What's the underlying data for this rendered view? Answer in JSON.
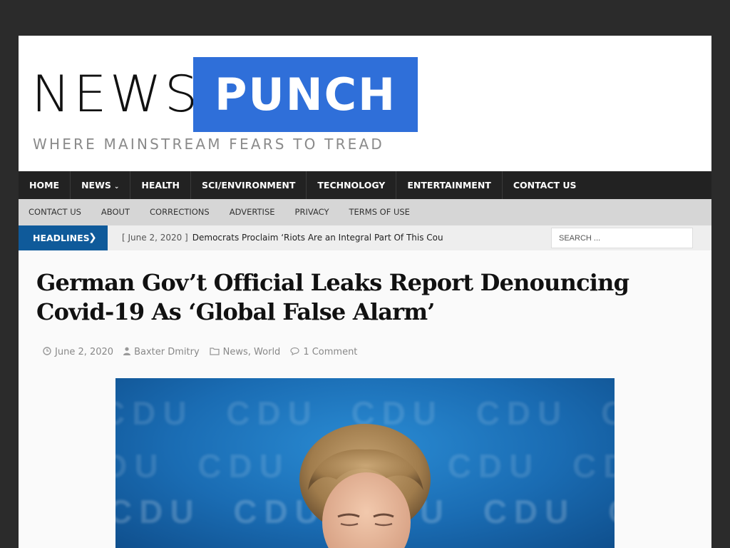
{
  "header": {
    "logo_word_1": "NEWS",
    "logo_word_2": "PUNCH",
    "tagline": "WHERE MAINSTREAM FEARS TO TREAD",
    "brand_color": "#2f6fd9"
  },
  "main_nav": {
    "items": [
      {
        "label": "HOME"
      },
      {
        "label": "NEWS",
        "has_dropdown": true
      },
      {
        "label": "HEALTH"
      },
      {
        "label": "SCI/ENVIRONMENT"
      },
      {
        "label": "TECHNOLOGY"
      },
      {
        "label": "ENTERTAINMENT"
      },
      {
        "label": "CONTACT US"
      }
    ]
  },
  "sub_nav": {
    "items": [
      {
        "label": "CONTACT US"
      },
      {
        "label": "ABOUT"
      },
      {
        "label": "CORRECTIONS"
      },
      {
        "label": "ADVERTISE"
      },
      {
        "label": "PRIVACY"
      },
      {
        "label": "TERMS OF USE"
      }
    ]
  },
  "ticker": {
    "label": "HEADLINES",
    "date": "[ June 2, 2020 ]",
    "headline": "Democrats Proclaim ‘Riots Are an Integral Part Of This Country’s"
  },
  "search": {
    "placeholder": "SEARCH ..."
  },
  "article": {
    "title": "German Gov’t Official Leaks Report Denouncing Covid-19 As ‘Global False Alarm’",
    "date": "June 2, 2020",
    "author": "Baxter Dmitry",
    "categories": [
      "News",
      "World"
    ],
    "comments": "1 Comment",
    "hero_text": "CDU"
  },
  "icons": {
    "date": "clock-icon",
    "author": "user-icon",
    "category": "folder-icon",
    "comments": "comment-icon",
    "ticker_arrow": "chevron-right-icon",
    "dropdown": "chevron-down-icon"
  }
}
